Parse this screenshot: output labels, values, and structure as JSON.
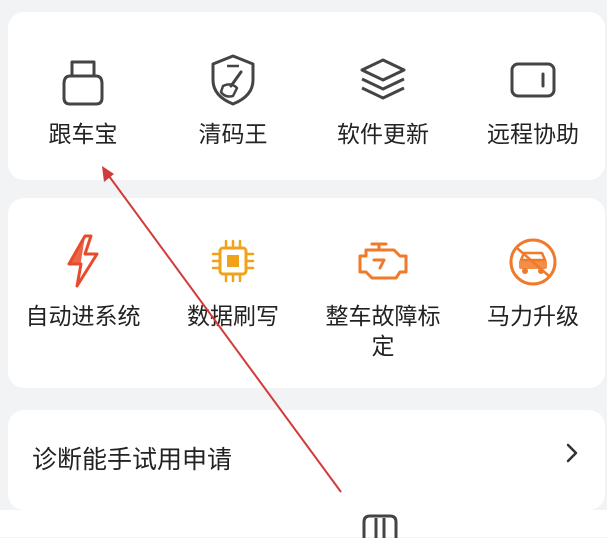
{
  "top_grid": {
    "items": [
      {
        "label": "跟车宝",
        "icon": "obd-connector-icon"
      },
      {
        "label": "清码王",
        "icon": "shield-broom-icon"
      },
      {
        "label": "软件更新",
        "icon": "layers-icon"
      },
      {
        "label": "远程协助",
        "icon": "remote-device-icon"
      }
    ]
  },
  "feature_grid": {
    "items": [
      {
        "label": "自动进系统",
        "icon": "lightning-icon",
        "color": "#e84b2b"
      },
      {
        "label": "数据刷写",
        "icon": "chip-icon",
        "color": "#f0a318"
      },
      {
        "label": "整车故障标定",
        "icon": "engine-icon",
        "color": "#f07a2a"
      },
      {
        "label": "马力升级",
        "icon": "gauge-car-icon",
        "color": "#f07a2a"
      }
    ]
  },
  "menu": {
    "trial_label": "诊断能手试用申请"
  },
  "colors": {
    "annotation_arrow": "#d33a3a",
    "card_bg": "#ffffff",
    "page_bg": "#f2f3f5"
  }
}
